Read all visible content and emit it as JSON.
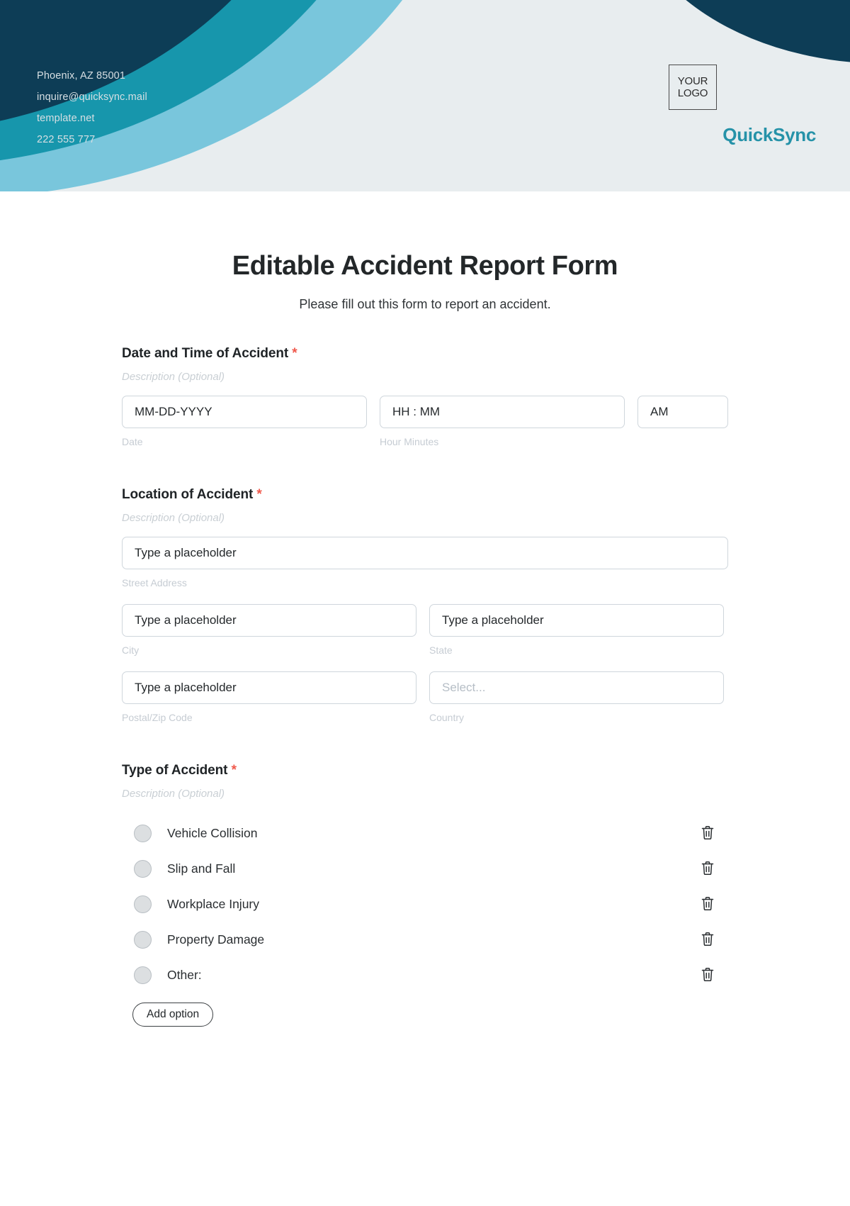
{
  "header": {
    "contact_lines": [
      "Phoenix, AZ 85001",
      "inquire@quicksync.mail",
      "template.net",
      "222 555 777"
    ],
    "logo_line1": "YOUR",
    "logo_line2": "LOGO",
    "brand_name": "QuickSync",
    "colors": {
      "navy": "#0d3d56",
      "teal": "#1796ac",
      "pale_blue": "#79c6dc",
      "light_bg": "#e8edef",
      "brand_text": "#2592a8"
    }
  },
  "page": {
    "title": "Editable Accident Report Form",
    "subtitle": "Please fill out this form to report an accident.",
    "required_marker": "*",
    "required_color": "#f0594c"
  },
  "sections": {
    "datetime": {
      "title": "Date and Time of Accident",
      "description": "Description (Optional)",
      "date_placeholder": "MM-DD-YYYY",
      "date_sublabel": "Date",
      "time_placeholder": "HH : MM",
      "time_sublabel": "Hour Minutes",
      "meridiem_value": "AM"
    },
    "location": {
      "title": "Location of Accident",
      "description": "Description (Optional)",
      "street_placeholder": "Type a placeholder",
      "street_sublabel": "Street Address",
      "city_placeholder": "Type a placeholder",
      "city_sublabel": "City",
      "state_placeholder": "Type a placeholder",
      "state_sublabel": "State",
      "postal_placeholder": "Type a placeholder",
      "postal_sublabel": "Postal/Zip Code",
      "country_placeholder": "Select...",
      "country_sublabel": "Country"
    },
    "accident_type": {
      "title": "Type of Accident",
      "description": "Description (Optional)",
      "options": [
        {
          "label": "Vehicle Collision",
          "selected": false,
          "delete_icon": "trash-icon"
        },
        {
          "label": "Slip and Fall",
          "selected": false,
          "delete_icon": "trash-icon"
        },
        {
          "label": "Workplace Injury",
          "selected": false,
          "delete_icon": "trash-icon"
        },
        {
          "label": "Property Damage",
          "selected": false,
          "delete_icon": "trash-icon"
        },
        {
          "label": "Other:",
          "selected": false,
          "delete_icon": "trash-icon"
        }
      ],
      "add_option_label": "Add option"
    }
  }
}
